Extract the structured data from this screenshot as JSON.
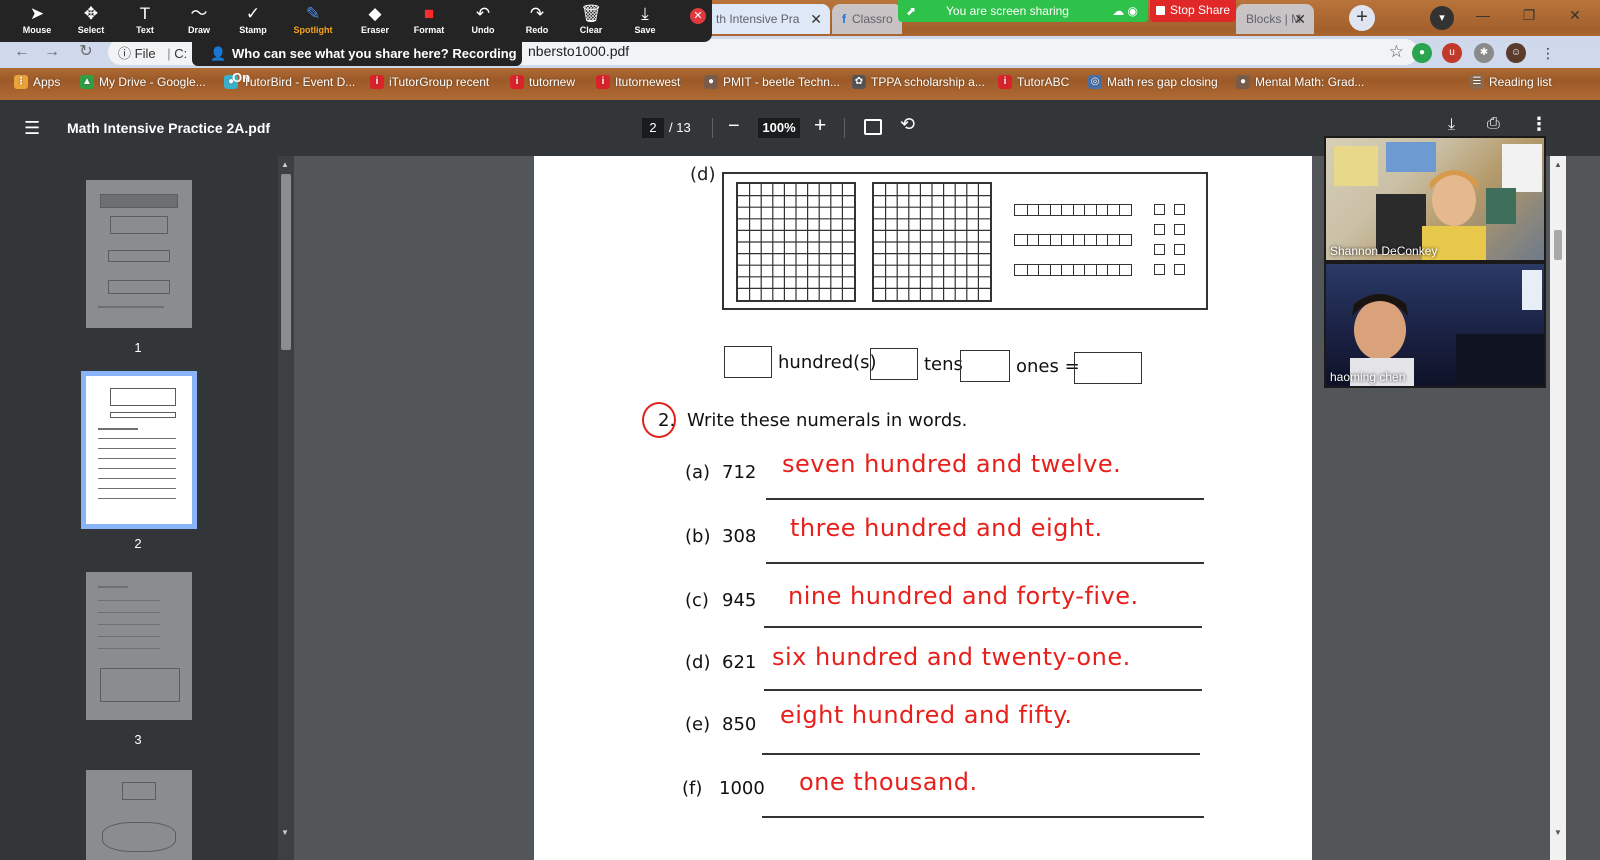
{
  "zoom_toolbar": {
    "tools": [
      {
        "label": "Mouse",
        "icon": "cursor-icon",
        "glyph": "➤"
      },
      {
        "label": "Select",
        "icon": "move-icon",
        "glyph": "✥"
      },
      {
        "label": "Text",
        "icon": "text-icon",
        "glyph": "T"
      },
      {
        "label": "Draw",
        "icon": "draw-icon",
        "glyph": "〜"
      },
      {
        "label": "Stamp",
        "icon": "stamp-icon",
        "glyph": "✓"
      },
      {
        "label": "Spotlight",
        "icon": "spotlight-icon",
        "glyph": "✎"
      },
      {
        "label": "Eraser",
        "icon": "eraser-icon",
        "glyph": "◆"
      },
      {
        "label": "Format",
        "icon": "format-icon",
        "glyph": "■"
      },
      {
        "label": "Undo",
        "icon": "undo-icon",
        "glyph": "↶"
      },
      {
        "label": "Redo",
        "icon": "redo-icon",
        "glyph": "↷"
      },
      {
        "label": "Clear",
        "icon": "trash-icon",
        "glyph": "🗑"
      },
      {
        "label": "Save",
        "icon": "save-icon",
        "glyph": "⤓"
      }
    ],
    "recording_banner": "Who can see what you share here? Recording On",
    "share_banner": "You are screen sharing",
    "stop_share": "Stop Share"
  },
  "browser": {
    "tabs": [
      {
        "title": "th Intensive Pra"
      },
      {
        "title": "Classro"
      },
      {
        "title": "Blocks | M"
      }
    ],
    "address": {
      "info_label": "File",
      "path_prefix": "C:",
      "path_suffix": "nbersto1000.pdf"
    },
    "bookmarks": [
      {
        "label": "Apps",
        "color": "#e9a33a",
        "glyph": "⋮"
      },
      {
        "label": "My Drive - Google...",
        "color": "#2f9e44",
        "glyph": "▲"
      },
      {
        "label": "TutorBird - Event D...",
        "color": "#3ab0c9",
        "glyph": "●"
      },
      {
        "label": "iTutorGroup recent",
        "color": "#d9232b",
        "glyph": "i"
      },
      {
        "label": "tutornew",
        "color": "#d9232b",
        "glyph": "i"
      },
      {
        "label": "Itutornewest",
        "color": "#d9232b",
        "glyph": "i"
      },
      {
        "label": "PMIT - beetle Techn...",
        "color": "#7a5c4a",
        "glyph": "●"
      },
      {
        "label": "TPPA scholarship a...",
        "color": "#555555",
        "glyph": "✿"
      },
      {
        "label": "TutorABC",
        "color": "#d9232b",
        "glyph": "i"
      },
      {
        "label": "Math res gap closing",
        "color": "#4a6fa5",
        "glyph": "◎"
      },
      {
        "label": "Mental Math: Grad...",
        "color": "#7a5c4a",
        "glyph": "●"
      },
      {
        "label": "Reading list",
        "color": "#8a6a50",
        "glyph": "☰"
      }
    ]
  },
  "pdf": {
    "title": "Math Intensive Practice 2A.pdf",
    "current_page": "2",
    "total_pages": "/ 13",
    "zoom": "100%",
    "thumbnails": [
      "1",
      "2",
      "3"
    ]
  },
  "document": {
    "part_d_label": "(d)",
    "box_words": {
      "hundreds": "hundred(s)",
      "tens": "tens",
      "ones": "ones ="
    },
    "question": {
      "number": "2.",
      "prompt": "Write these numerals in words."
    },
    "items": [
      {
        "label": "(a)",
        "numeral": "712",
        "answer": "seven hundred and twelve."
      },
      {
        "label": "(b)",
        "numeral": "308",
        "answer": "three hundred and eight."
      },
      {
        "label": "(c)",
        "numeral": "945",
        "answer": "nine hundred and forty-five."
      },
      {
        "label": "(d)",
        "numeral": "621",
        "answer": "six hundred and twenty-one."
      },
      {
        "label": "(e)",
        "numeral": "850",
        "answer": "eight hundred and fifty."
      },
      {
        "label": "(f)",
        "numeral": "1000",
        "answer": "one thousand."
      }
    ]
  },
  "participants": [
    {
      "name": "Shannon DeConkey"
    },
    {
      "name": "haoming   chen"
    }
  ],
  "colors": {
    "annotation_red": "#e8201c",
    "share_green": "#2ec24b",
    "stop_red": "#e02828",
    "spotlight_orange": "#f7a21b"
  }
}
